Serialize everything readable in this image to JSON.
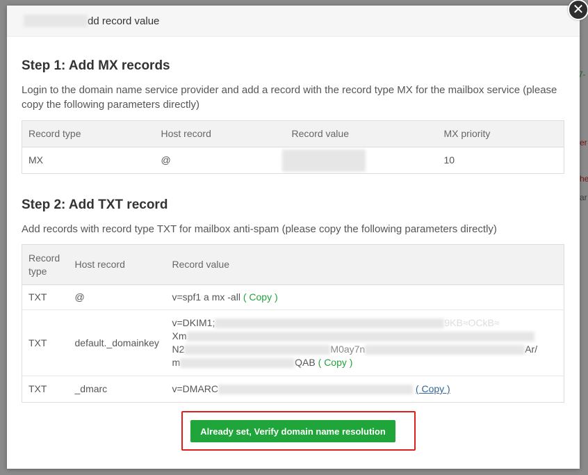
{
  "dialog": {
    "title": "dd record value",
    "close_glyph": "✕"
  },
  "step1": {
    "title": "Step 1: Add MX records",
    "desc": "Login to the domain name service provider and add a record with the record type MX for the mailbox service (please copy the following parameters directly)",
    "columns": [
      "Record type",
      "Host record",
      "Record value",
      "MX priority"
    ],
    "row": {
      "type": "MX",
      "host": "@",
      "priority": "10"
    }
  },
  "step2": {
    "title": "Step 2: Add TXT record",
    "desc": "Add records with record type TXT for mailbox anti-spam (please copy the following parameters directly)",
    "columns": [
      "Record type",
      "Host record",
      "Record value"
    ],
    "rows": [
      {
        "type": "TXT",
        "host": "@",
        "value": "v=spf1 a mx -all",
        "copy": "( Copy )"
      },
      {
        "type": "TXT",
        "host": "default._domainkey",
        "value_line1": "v=DKIM1;",
        "value_line1_tail": "9KB≈OCkB≈",
        "value_line2": "Xm",
        "value_line3": "N2",
        "value_line3_mid": "M0ay7n",
        "value_line3_tail": "Ar/",
        "value_line4": "m",
        "value_line4_tail": "QAB",
        "copy": "( Copy )"
      },
      {
        "type": "TXT",
        "host": "_dmarc",
        "value": "v=DMARC",
        "copy": "( Copy )"
      }
    ]
  },
  "verify_button": "Already set, Verify domain name resolution",
  "background": {
    "frag1": "7-",
    "frag2": "er",
    "frag3": "he",
    "frag4": "ar"
  },
  "colors": {
    "primary_green": "#20a53a",
    "highlight_red": "#e01e1e"
  }
}
